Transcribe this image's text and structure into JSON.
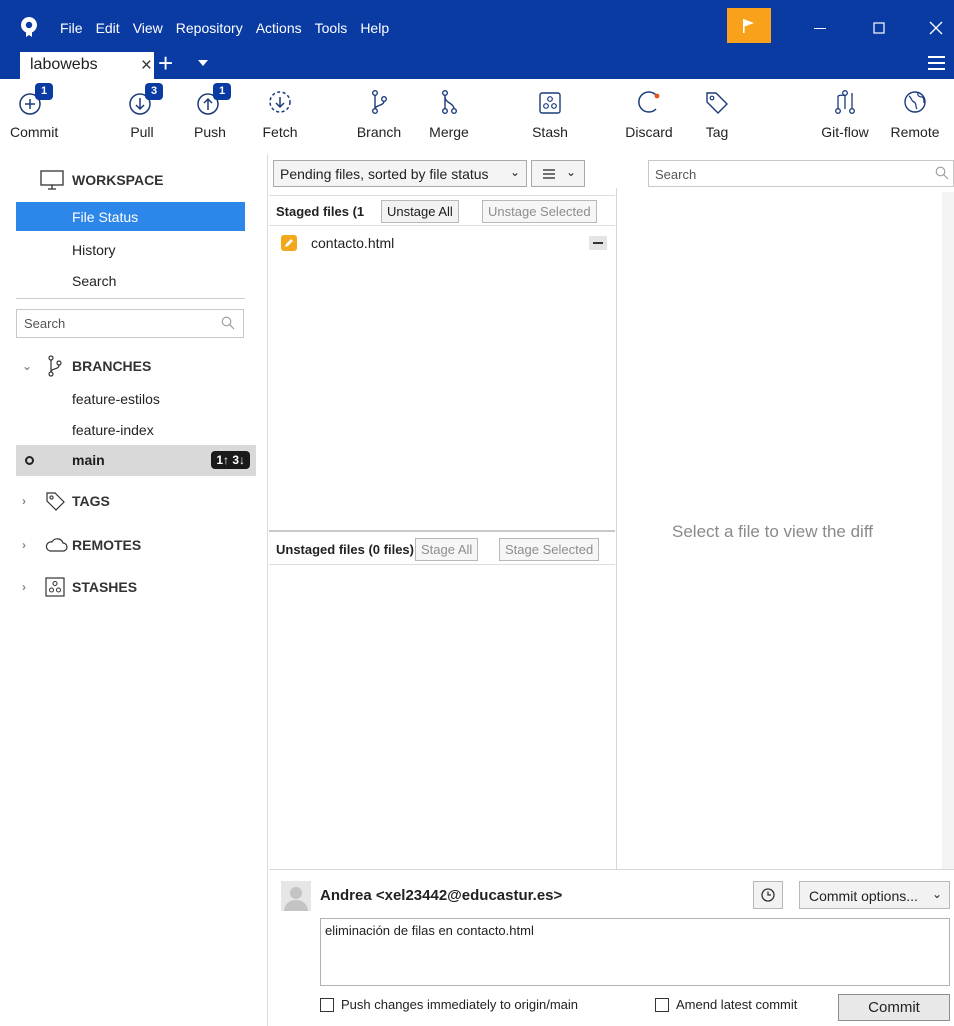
{
  "app": {
    "menu": [
      "File",
      "Edit",
      "View",
      "Repository",
      "Actions",
      "Tools",
      "Help"
    ],
    "tab_label": "labowebs",
    "tab_close": "×",
    "new_tab": "+"
  },
  "colors": {
    "titlebar": "#0a3ba3",
    "selection": "#2d86e9",
    "flag": "#f9a11b",
    "modified_file": "#f3a81c"
  },
  "toolbar": {
    "commit": {
      "label": "Commit",
      "badge": "1",
      "icon": "commit-icon"
    },
    "pull": {
      "label": "Pull",
      "badge": "3",
      "icon": "pull-icon"
    },
    "push": {
      "label": "Push",
      "badge": "1",
      "icon": "push-icon"
    },
    "fetch": {
      "label": "Fetch",
      "icon": "fetch-icon"
    },
    "branch": {
      "label": "Branch",
      "icon": "branch-icon"
    },
    "merge": {
      "label": "Merge",
      "icon": "merge-icon"
    },
    "stash": {
      "label": "Stash",
      "icon": "stash-icon"
    },
    "discard": {
      "label": "Discard",
      "icon": "discard-icon"
    },
    "tag": {
      "label": "Tag",
      "icon": "tag-icon"
    },
    "gitflow": {
      "label": "Git-flow",
      "icon": "git-flow-icon"
    },
    "remote": {
      "label": "Remote",
      "icon": "globe-icon"
    }
  },
  "sidebar": {
    "workspace": "WORKSPACE",
    "nav": [
      "File Status",
      "History",
      "Search"
    ],
    "search_placeholder": "Search",
    "branches_header": "BRANCHES",
    "branches": [
      "feature-estilos",
      "feature-index"
    ],
    "current_branch": {
      "name": "main",
      "badge": "1↑ 3↓"
    },
    "tags_header": "TAGS",
    "remotes_header": "REMOTES",
    "stashes_header": "STASHES"
  },
  "files": {
    "sort_label": "Pending files, sorted by file status",
    "staged_header": "Staged files  (1",
    "unstage_all": "Unstage All",
    "unstage_selected": "Unstage Selected",
    "staged_files": [
      "contacto.html"
    ],
    "unstaged_header": "Unstaged files  (0 files)",
    "stage_all": "Stage All",
    "stage_selected": "Stage Selected"
  },
  "diff": {
    "search_placeholder": "Search",
    "empty_message": "Select a file to view the diff"
  },
  "commit": {
    "author": "Andrea <xel23442@educastur.es>",
    "options_label": "Commit options...",
    "message": "eliminación de filas en contacto.html",
    "push_checkbox": "Push changes immediately to origin/main",
    "amend_checkbox": "Amend latest commit",
    "commit_button": "Commit"
  }
}
